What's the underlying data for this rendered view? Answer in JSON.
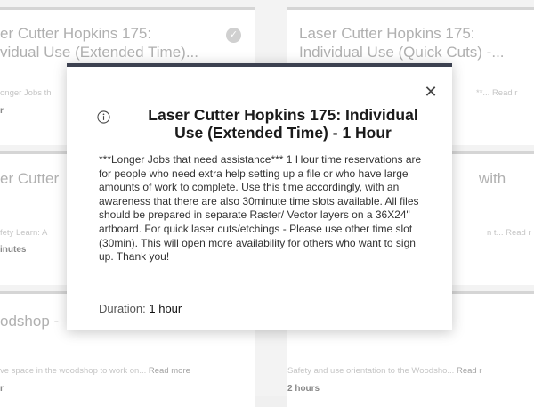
{
  "cards": [
    {
      "title_line1": "er Cutter Hopkins 175:",
      "title_line2": "vidual Use (Extended Time)...",
      "desc": "onger Jobs th",
      "read_more": "",
      "duration": "r",
      "checked": true
    },
    {
      "title_line1": "Laser Cutter Hopkins 175:",
      "title_line2": "Individual Use (Quick Cuts) -...",
      "desc": "**... Read r",
      "read_more": "",
      "duration": "",
      "checked": false
    },
    {
      "title_line1": "er Cutter",
      "title_line2": "",
      "desc": "fety Learn: A",
      "read_more": "",
      "duration": "inutes",
      "checked": false
    },
    {
      "title_line1": "with",
      "title_line2": "",
      "desc": "n t... Read r",
      "read_more": "",
      "duration": "",
      "checked": false
    },
    {
      "title_line1": "odshop -",
      "title_line2": "",
      "desc": "ve space in the woodshop to work on...",
      "read_more": "Read more",
      "duration": "r",
      "checked": false
    },
    {
      "title_line1": "",
      "title_line2": "",
      "desc": "Safety and use orientation to the Woodsho...",
      "read_more": "Read r",
      "duration": "2 hours",
      "checked": false
    }
  ],
  "modal": {
    "title": "Laser Cutter Hopkins 175: Individual\nUse (Extended Time) - 1 Hour",
    "description": "***Longer Jobs that need assistance*** 1 Hour time reservations are for people who need extra help setting up a file or who have large amounts of work to complete. Use this time accordingly, with an awareness that there are also 30minute time slots available. All files should be prepared in separate Raster/ Vector layers on a 36X24\" artboard. For quick laser cuts/etchings - Please use other time slot (30min). This will open more availability for others who want to sign up. Thank you!",
    "duration_label": "Duration:",
    "duration_value": "1 hour",
    "close_glyph": "✕"
  }
}
